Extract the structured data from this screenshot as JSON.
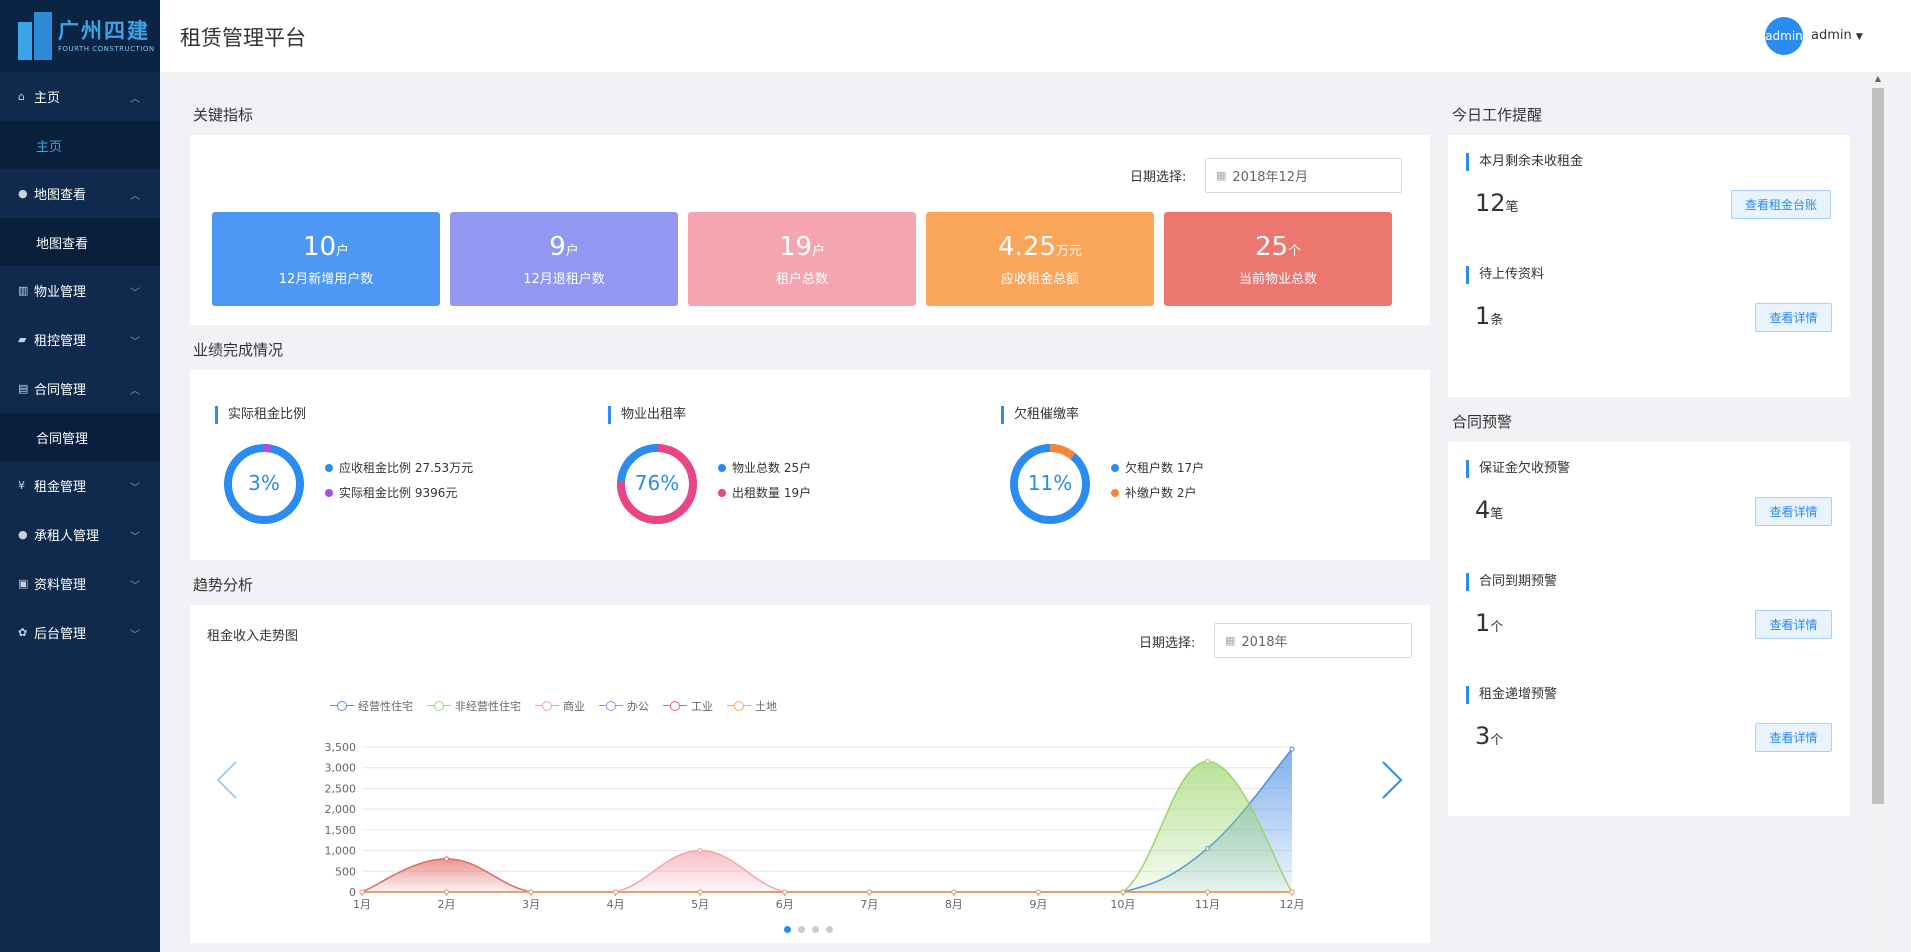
{
  "brand": {
    "name_cn": "广州四建",
    "name_en": "FOURTH CONSTRUCTION"
  },
  "header": {
    "title": "租赁管理平台",
    "avatar": "admin",
    "user": "admin"
  },
  "sidebar": [
    {
      "label": "主页",
      "icon": "home-icon",
      "expanded": true,
      "sub": "主页",
      "active": true
    },
    {
      "label": "地图查看",
      "icon": "map-pin-icon",
      "expanded": true,
      "sub": "地图查看"
    },
    {
      "label": "物业管理",
      "icon": "building-icon",
      "expanded": false
    },
    {
      "label": "租控管理",
      "icon": "briefcase-icon",
      "expanded": false
    },
    {
      "label": "合同管理",
      "icon": "document-icon",
      "expanded": true,
      "sub": "合同管理"
    },
    {
      "label": "租金管理",
      "icon": "yen-icon",
      "expanded": false
    },
    {
      "label": "承租人管理",
      "icon": "user-icon",
      "expanded": false
    },
    {
      "label": "资料管理",
      "icon": "archive-icon",
      "expanded": false
    },
    {
      "label": "后台管理",
      "icon": "gear-icon",
      "expanded": false
    }
  ],
  "key_metrics": {
    "title": "关键指标",
    "date_label": "日期选择:",
    "date_value": "2018年12月",
    "cards": [
      {
        "value": "10",
        "unit": "户",
        "label": "12月新增用户数",
        "color": "#4e97f3"
      },
      {
        "value": "9",
        "unit": "户",
        "label": "12月退租户数",
        "color": "#9298f2"
      },
      {
        "value": "19",
        "unit": "户",
        "label": "租户总数",
        "color": "#f4a5b0"
      },
      {
        "value": "4.25",
        "unit": "万元",
        "label": "应收租金总额",
        "color": "#f9a55a"
      },
      {
        "value": "25",
        "unit": "个",
        "label": "当前物业总数",
        "color": "#ec7770"
      }
    ]
  },
  "performance": {
    "title": "业绩完成情况",
    "rings": [
      {
        "title": "实际租金比例",
        "percent": "3%",
        "fraction": 0.03,
        "main_color": "#2a8cf0",
        "accent_color": "#b04be0",
        "legend": [
          {
            "text": "应收租金比例 27.53万元",
            "color": "#2a8cf0"
          },
          {
            "text": "实际租金比例 9396元",
            "color": "#b04be0"
          }
        ]
      },
      {
        "title": "物业出租率",
        "percent": "76%",
        "fraction": 0.76,
        "main_color": "#2a8cf0",
        "accent_color": "#ec4585",
        "legend": [
          {
            "text": "物业总数 25户",
            "color": "#2a8cf0"
          },
          {
            "text": "出租数量 19户",
            "color": "#ec4585"
          }
        ]
      },
      {
        "title": "欠租催缴率",
        "percent": "11%",
        "fraction": 0.11,
        "main_color": "#2a8cf0",
        "accent_color": "#f2873c",
        "legend": [
          {
            "text": "欠租户数 17户",
            "color": "#2a8cf0"
          },
          {
            "text": "补缴户数 2户",
            "color": "#f2873c"
          }
        ]
      }
    ]
  },
  "trend": {
    "title": "趋势分析",
    "chart_title": "租金收入走势图",
    "date_label": "日期选择:",
    "date_value": "2018年"
  },
  "chart_data": {
    "type": "area",
    "title": "租金收入走势图",
    "categories": [
      "1月",
      "2月",
      "3月",
      "4月",
      "5月",
      "6月",
      "7月",
      "8月",
      "9月",
      "10月",
      "11月",
      "12月"
    ],
    "ylim": [
      0,
      3500
    ],
    "yticks": [
      0,
      500,
      1000,
      1500,
      2000,
      2500,
      3000,
      3500
    ],
    "grid": true,
    "legend_position": "top-left",
    "series": [
      {
        "name": "经营性住宅",
        "color": "#4a90e2",
        "values": [
          0,
          0,
          0,
          0,
          0,
          0,
          0,
          0,
          0,
          0,
          1050,
          3450
        ]
      },
      {
        "name": "非经营性住宅",
        "color": "#9ad66b",
        "values": [
          0,
          0,
          0,
          0,
          0,
          0,
          0,
          0,
          0,
          0,
          3150,
          0
        ]
      },
      {
        "name": "商业",
        "color": "#f4a3ad",
        "values": [
          0,
          0,
          0,
          0,
          1000,
          0,
          0,
          0,
          0,
          0,
          0,
          0
        ]
      },
      {
        "name": "办公",
        "color": "#8c95e8",
        "values": [
          0,
          0,
          0,
          0,
          0,
          0,
          0,
          0,
          0,
          0,
          0,
          0
        ]
      },
      {
        "name": "工业",
        "color": "#e06a64",
        "values": [
          0,
          800,
          0,
          0,
          0,
          0,
          0,
          0,
          0,
          0,
          0,
          0
        ]
      },
      {
        "name": "土地",
        "color": "#f5a35c",
        "values": [
          0,
          0,
          0,
          0,
          0,
          0,
          0,
          0,
          0,
          0,
          0,
          0
        ]
      }
    ]
  },
  "reminders": {
    "title": "今日工作提醒",
    "items": [
      {
        "title": "本月剩余未收租金",
        "value": "12",
        "unit": "笔",
        "button": "查看租金台账"
      },
      {
        "title": "待上传资料",
        "value": "1",
        "unit": "条",
        "button": "查看详情"
      }
    ]
  },
  "warnings": {
    "title": "合同预警",
    "items": [
      {
        "title": "保证金欠收预警",
        "value": "4",
        "unit": "笔",
        "button": "查看详情"
      },
      {
        "title": "合同到期预警",
        "value": "1",
        "unit": "个",
        "button": "查看详情"
      },
      {
        "title": "租金递增预警",
        "value": "3",
        "unit": "个",
        "button": "查看详情"
      }
    ]
  }
}
